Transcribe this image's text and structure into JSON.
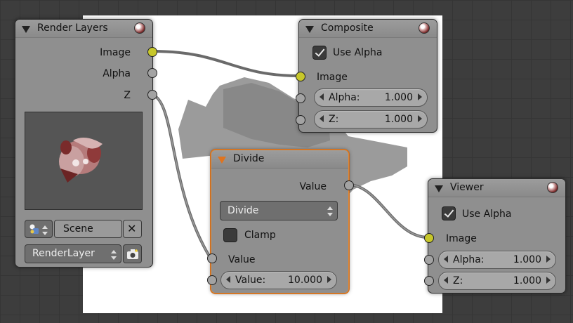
{
  "colors": {
    "grid_bg": "#3d3d3d",
    "node_body": "#8f8f8f",
    "socket_color": "#c7c72a",
    "socket_value": "#a3a3a3",
    "active_border": "#e2842c",
    "link": "#8a8a8a"
  },
  "render_layers": {
    "title": "Render Layers",
    "outputs": [
      "Image",
      "Alpha",
      "Z"
    ],
    "scene_icon": "scene-icon",
    "scene": "Scene",
    "clear_icon": "close-icon",
    "layer": "RenderLayer",
    "camera_icon": "camera-icon"
  },
  "composite": {
    "title": "Composite",
    "use_alpha_label": "Use Alpha",
    "use_alpha": true,
    "input_image": "Image",
    "alpha_label": "Alpha:",
    "alpha_value": "1.000",
    "z_label": "Z:",
    "z_value": "1.000"
  },
  "divide": {
    "title": "Divide",
    "output_value": "Value",
    "operation": "Divide",
    "clamp_label": "Clamp",
    "clamp": false,
    "input_value": "Value",
    "value_label": "Value:",
    "value_value": "10.000"
  },
  "viewer": {
    "title": "Viewer",
    "use_alpha_label": "Use Alpha",
    "use_alpha": true,
    "input_image": "Image",
    "alpha_label": "Alpha:",
    "alpha_value": "1.000",
    "z_label": "Z:",
    "z_value": "1.000"
  }
}
